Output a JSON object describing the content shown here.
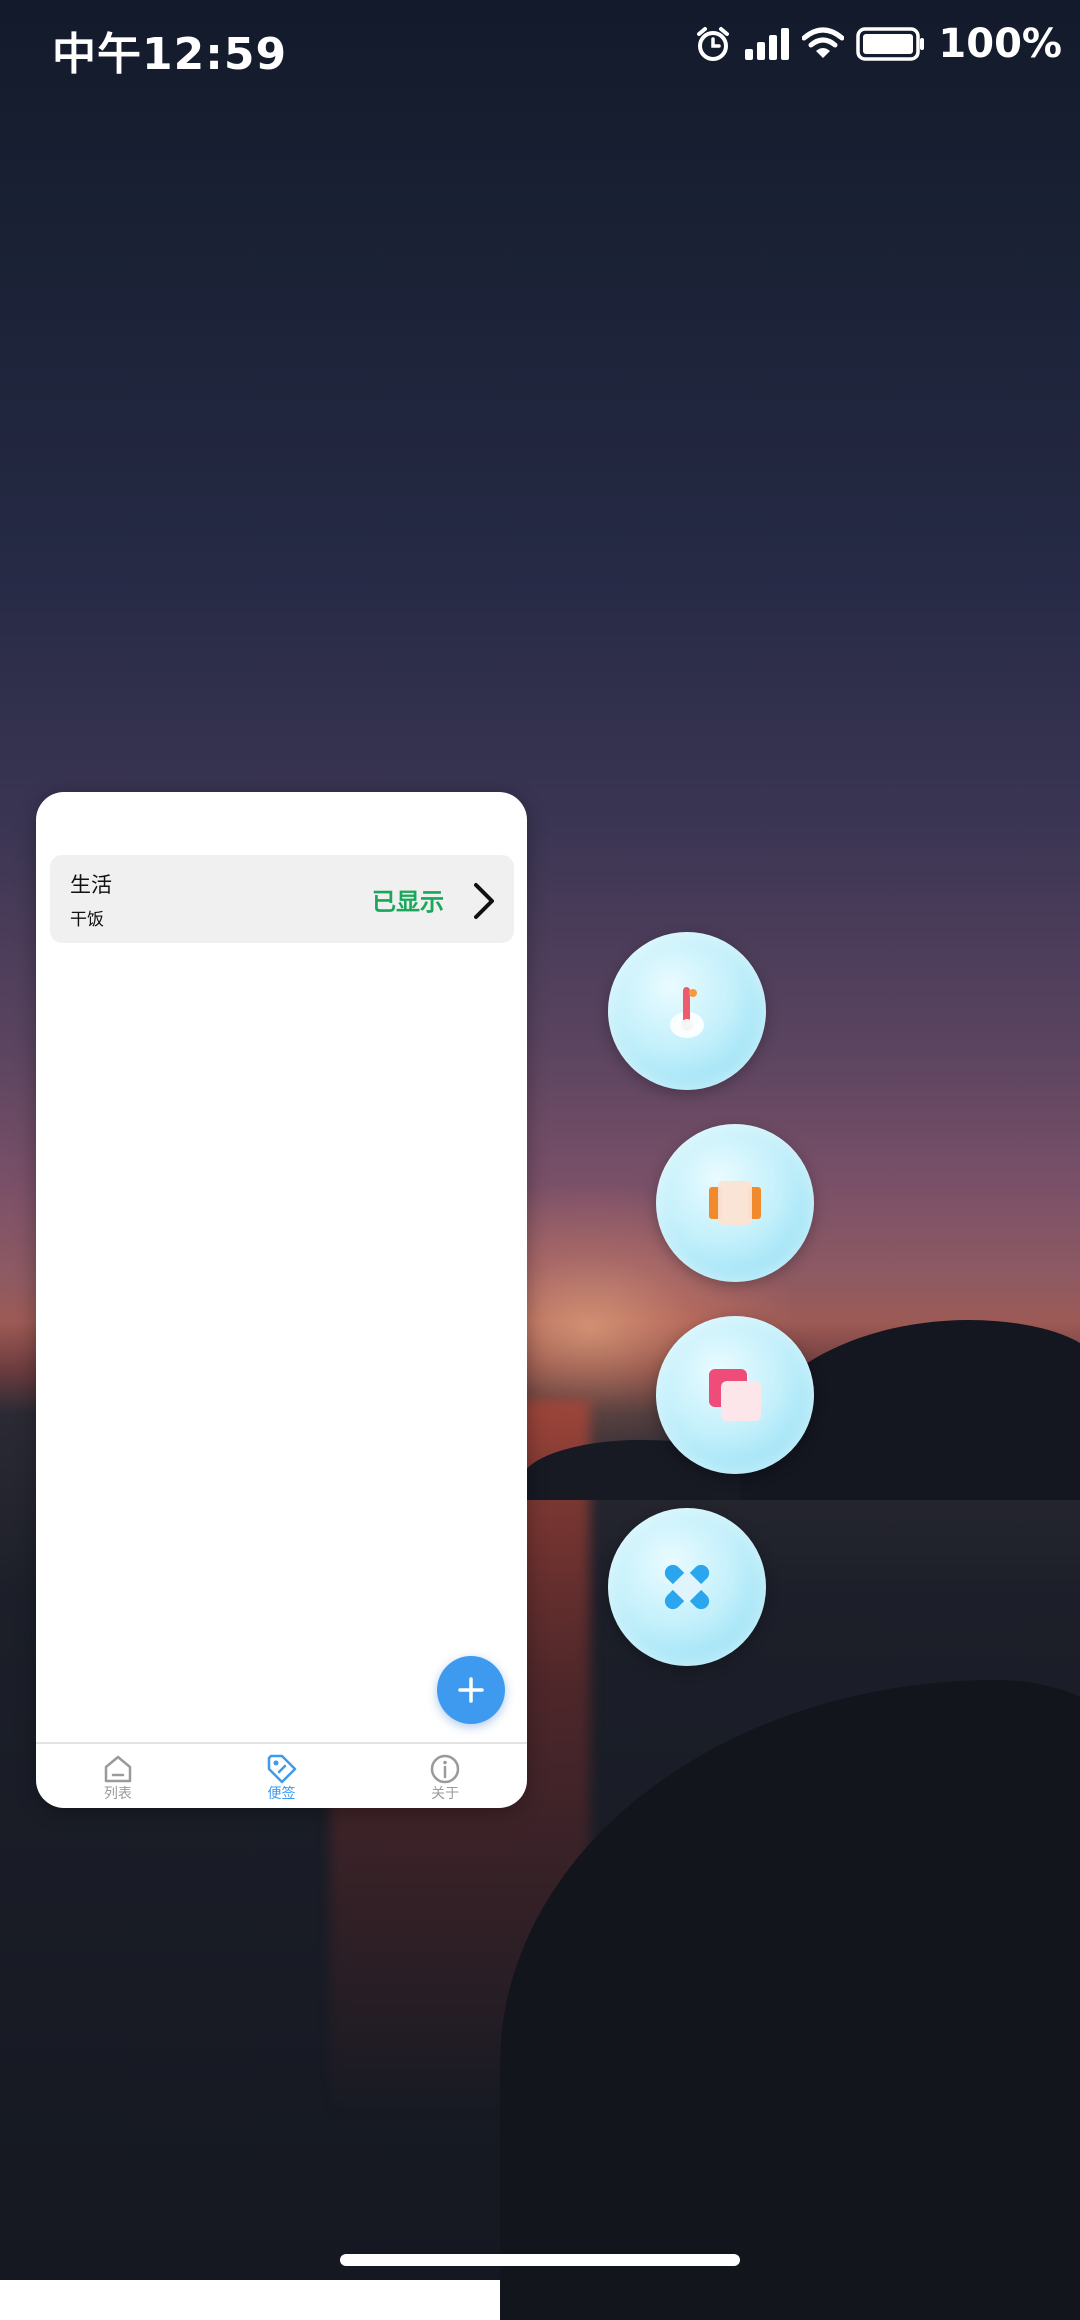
{
  "status_bar": {
    "time": "中午12:59",
    "battery": "100%",
    "icons": [
      "alarm-icon",
      "signal-icon",
      "wifi-icon",
      "battery-icon"
    ]
  },
  "widget": {
    "note": {
      "title": "生活",
      "subtitle": "干饭",
      "status": "已显示",
      "status_color": "#19a85a"
    },
    "add_button_icon": "plus-icon",
    "tabs": [
      {
        "label": "列表",
        "icon": "home-icon",
        "active": false
      },
      {
        "label": "便签",
        "icon": "tag-icon",
        "active": true
      },
      {
        "label": "关于",
        "icon": "info-icon",
        "active": false
      }
    ],
    "accent_color": "#3d9aef"
  },
  "floating_bubbles": [
    {
      "icon": "thermometer-icon"
    },
    {
      "icon": "film-strip-icon"
    },
    {
      "icon": "copy-cards-icon"
    },
    {
      "icon": "bandage-icon"
    }
  ]
}
